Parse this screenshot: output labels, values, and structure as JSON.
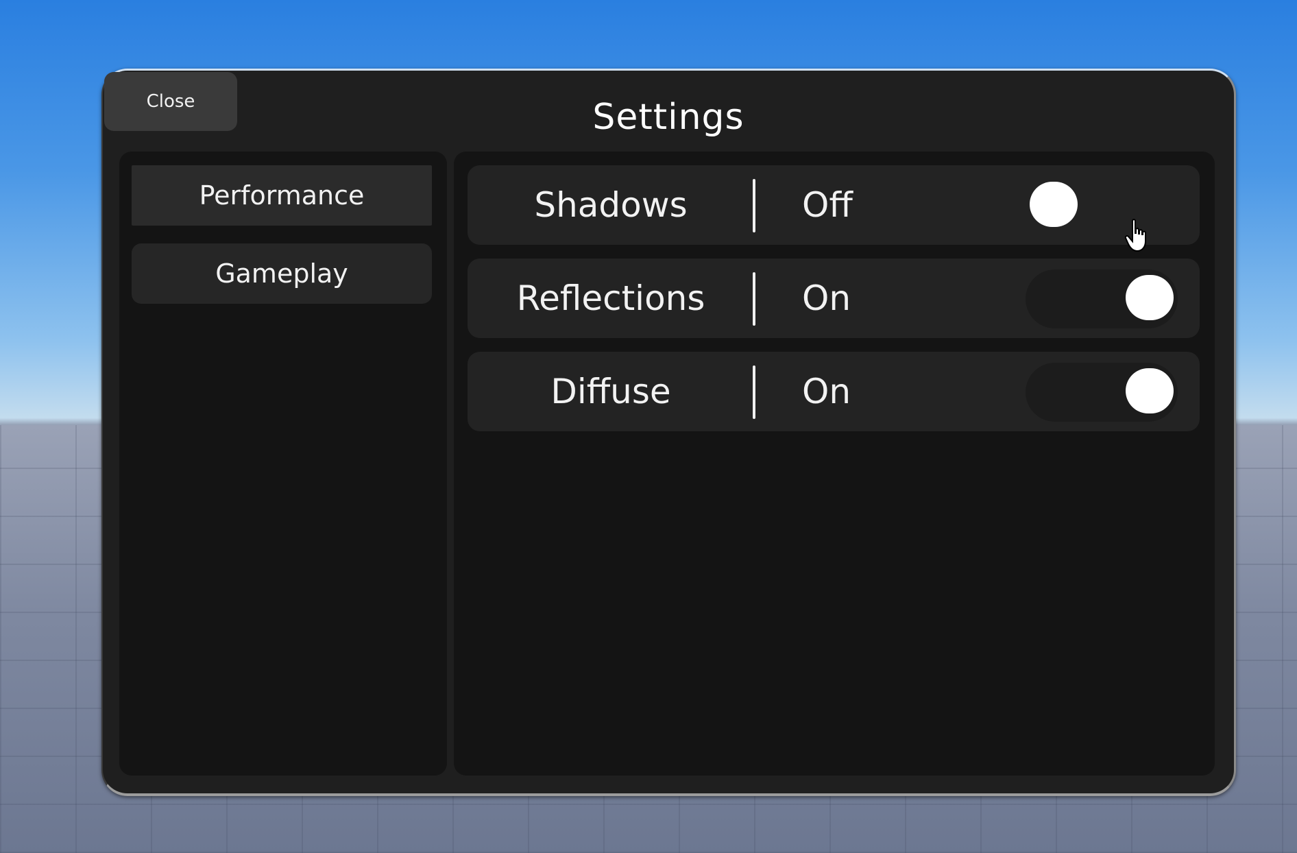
{
  "window": {
    "title": "Settings",
    "close_label": "Close"
  },
  "sidebar": {
    "items": [
      {
        "label": "Performance"
      },
      {
        "label": "Gameplay"
      }
    ]
  },
  "settings": [
    {
      "label": "Shadows",
      "state": "Off",
      "enabled": false
    },
    {
      "label": "Reflections",
      "state": "On",
      "enabled": true
    },
    {
      "label": "Diffuse",
      "state": "On",
      "enabled": true
    }
  ],
  "colors": {
    "panel": "#1f1f1f",
    "inner_panel": "#141414",
    "row": "#232323",
    "text": "#f2f2f2",
    "knob": "#ffffff"
  },
  "icons": {
    "cursor": "hand-pointer-icon"
  }
}
